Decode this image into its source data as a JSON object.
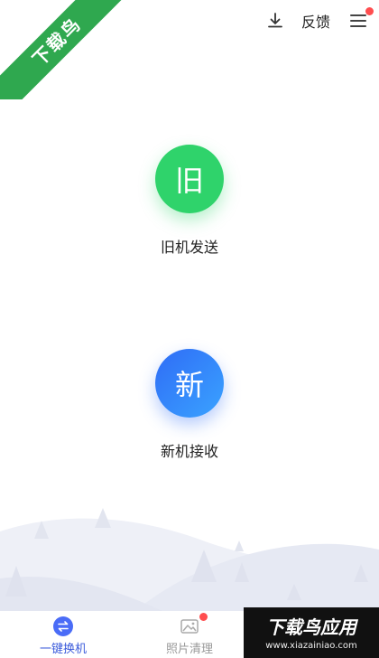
{
  "watermark": {
    "ribbon_text": "下载鸟",
    "corner_title": "下载鸟应用",
    "corner_url": "www.xiazainiao.com"
  },
  "toolbar": {
    "download_icon": "download-icon",
    "feedback_label": "反馈",
    "menu_icon": "hamburger-menu-icon",
    "menu_badge_color": "#ff4d4f"
  },
  "actions": {
    "old_phone": {
      "icon_text": "旧",
      "label": "旧机发送",
      "color": "#2fd36b"
    },
    "new_phone": {
      "icon_text": "新",
      "label": "新机接收",
      "color": "#2f6cf6"
    }
  },
  "bottom_nav": {
    "items": [
      {
        "label": "一键换机",
        "icon": "swap-arrows-icon",
        "active": true
      },
      {
        "label": "照片清理",
        "icon": "photo-icon",
        "badge": true,
        "badge_color": "#ff4d4f"
      },
      {
        "label": "",
        "icon": ""
      }
    ]
  }
}
